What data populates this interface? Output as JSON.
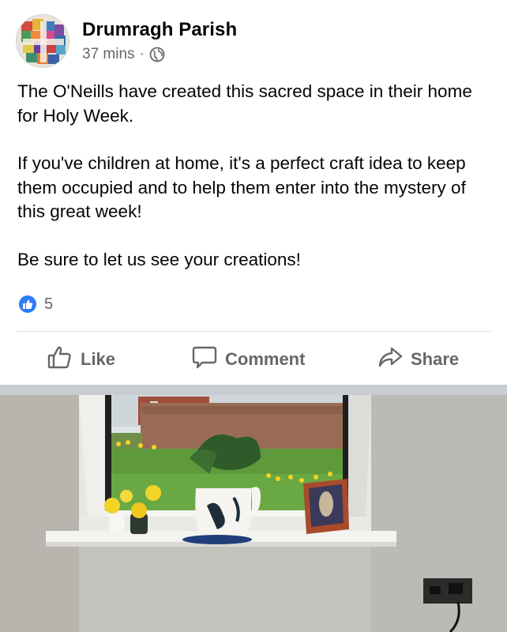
{
  "post": {
    "page_name": "Drumragh Parish",
    "time": "37 mins",
    "separator": "·",
    "audience_icon": "globe-icon",
    "paragraphs": [
      "The O'Neills have created this sacred space in their home for Holy Week.",
      "If you've children at home, it's a perfect craft idea to keep them occupied and to help them enter into the mystery of this great week!",
      "Be sure to let us see your creations!"
    ]
  },
  "reactions": {
    "icon": "thumbs-up-icon",
    "count": "5"
  },
  "actions": {
    "like_label": "Like",
    "comment_label": "Comment",
    "share_label": "Share"
  },
  "colors": {
    "like_blue": "#2e7cf6",
    "secondary_text": "#65676b",
    "wall": "#c4c2bd",
    "lawn": "#5e9a3c",
    "hedge": "#9a6c55",
    "daffodil": "#f2d327"
  }
}
